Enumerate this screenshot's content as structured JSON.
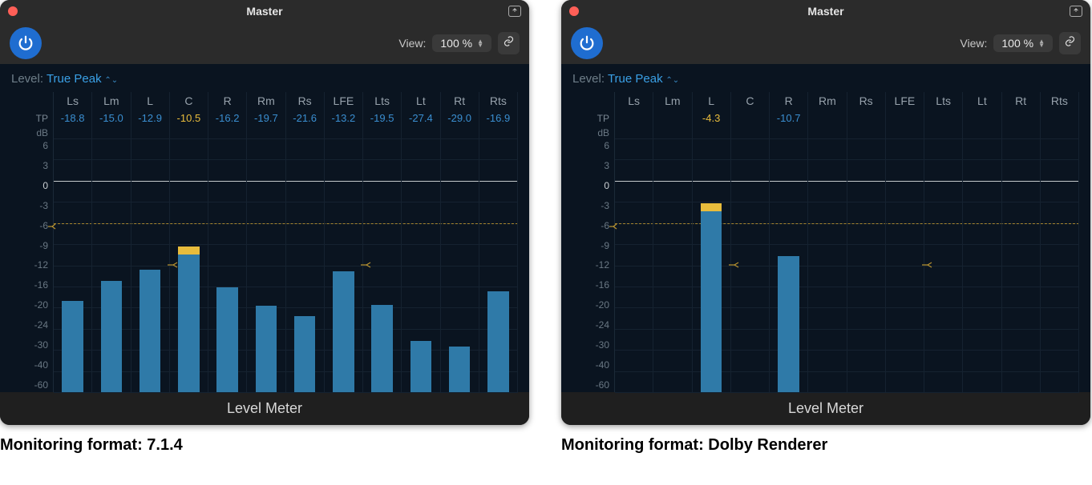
{
  "panels": [
    {
      "title": "Master",
      "view_label": "View:",
      "zoom": "100 %",
      "level_label": "Level:",
      "level_value": "True Peak",
      "tp_label": "TP",
      "db_label": "dB",
      "plugin_name": "Level Meter",
      "caption": "Monitoring format: 7.1.4",
      "channels": [
        "Ls",
        "Lm",
        "L",
        "C",
        "R",
        "Rm",
        "Rs",
        "LFE",
        "Lts",
        "Lt",
        "Rt",
        "Rts"
      ],
      "tp_values": [
        "-18.8",
        "-15.0",
        "-12.9",
        "-10.5",
        "-16.2",
        "-19.7",
        "-21.6",
        "-13.2",
        "-19.5",
        "-27.4",
        "-29.0",
        "-16.9"
      ],
      "max_index": 3,
      "threshold_markers_at": [
        3,
        8
      ],
      "main_threshold_db": -6,
      "secondary_threshold_db": -12
    },
    {
      "title": "Master",
      "view_label": "View:",
      "zoom": "100 %",
      "level_label": "Level:",
      "level_value": "True Peak",
      "tp_label": "TP",
      "db_label": "dB",
      "plugin_name": "Level Meter",
      "caption": "Monitoring format: Dolby Renderer",
      "channels": [
        "Ls",
        "Lm",
        "L",
        "C",
        "R",
        "Rm",
        "Rs",
        "LFE",
        "Lts",
        "Lt",
        "Rt",
        "Rts"
      ],
      "tp_values": [
        "",
        "",
        "-4.3",
        "",
        "-10.7",
        "",
        "",
        "",
        "",
        "",
        "",
        ""
      ],
      "max_index": 2,
      "threshold_markers_at": [
        3,
        8
      ],
      "main_threshold_db": -6,
      "secondary_threshold_db": -12
    }
  ],
  "y_ticks": [
    "6",
    "3",
    "0",
    "-3",
    "-6",
    "-9",
    "-12",
    "-16",
    "-20",
    "-24",
    "-30",
    "-40",
    "-60"
  ],
  "chart_data": [
    {
      "type": "bar",
      "title": "Level Meter — Monitoring format: 7.1.4",
      "categories": [
        "Ls",
        "Lm",
        "L",
        "C",
        "R",
        "Rm",
        "Rs",
        "LFE",
        "Lts",
        "Lt",
        "Rt",
        "Rts"
      ],
      "values": [
        -18.8,
        -15.0,
        -12.9,
        -10.5,
        -16.2,
        -19.7,
        -21.6,
        -13.2,
        -19.5,
        -27.4,
        -29.0,
        -16.9
      ],
      "ylabel": "dB (True Peak)",
      "ylim": [
        -60,
        6
      ],
      "threshold_db": -6
    },
    {
      "type": "bar",
      "title": "Level Meter — Monitoring format: Dolby Renderer",
      "categories": [
        "Ls",
        "Lm",
        "L",
        "C",
        "R",
        "Rm",
        "Rs",
        "LFE",
        "Lts",
        "Lt",
        "Rt",
        "Rts"
      ],
      "values": [
        null,
        null,
        -4.3,
        null,
        -10.7,
        null,
        null,
        null,
        null,
        null,
        null,
        null
      ],
      "ylabel": "dB (True Peak)",
      "ylim": [
        -60,
        6
      ],
      "threshold_db": -6
    }
  ]
}
